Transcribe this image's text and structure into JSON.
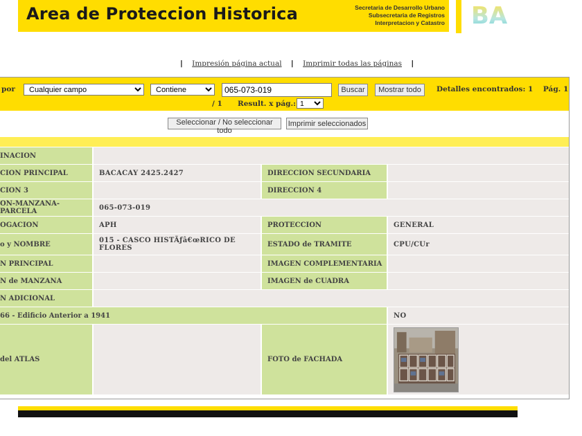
{
  "header": {
    "title": "Area de Proteccion Historica",
    "subtitle_lines": [
      "Secretaria de Desarrollo Urbano",
      "Subsecretaria de Registros",
      "Interpretacion y Catastro"
    ],
    "logo_text": "BA"
  },
  "print_links": {
    "current": "Impresión página actual",
    "all": "Imprimir todas las páginas"
  },
  "search": {
    "label": "por",
    "field_selected": "Cualquier campo",
    "operator_selected": "Contiene",
    "query_value": "065-073-019",
    "buscar_label": "Buscar",
    "mostrar_todo_label": "Mostrar todo",
    "detalles_text": "Detalles encontrados: 1",
    "pag_text": "Pág. 1",
    "pag_total_text": "/ 1",
    "result_label": "Result. x pág.:",
    "result_per_page": "1"
  },
  "actions": {
    "select_all_label": "Seleccionar / No seleccionar todo",
    "print_selected_label": "Imprimir seleccionados"
  },
  "record": {
    "denominacion_label": "INACION",
    "denominacion_value": "",
    "dir_principal_label": "CION PRINCIPAL",
    "dir_principal_value": "BACACAY 2425.2427",
    "dir_secundaria_label": "DIRECCION SECUNDARIA",
    "dir_secundaria_value": "",
    "dir3_label": "CION 3",
    "dir3_value": "",
    "dir4_label": "DIRECCION 4",
    "dir4_value": "",
    "smp_label": "ON-MANZANA-PARCELA",
    "smp_value": "065-073-019",
    "catalogacion_label": "OGACION",
    "catalogacion_value": "APH",
    "proteccion_label": "PROTECCION",
    "proteccion_value": "GENERAL",
    "nombre_label": "o y NOMBRE",
    "nombre_value": "015 - CASCO HISTÃƒâ€œRICO DE FLORES",
    "estado_label": "ESTADO de TRAMITE",
    "estado_value": "CPU/CUr",
    "img_principal_label": "N PRINCIPAL",
    "img_principal_value": "",
    "img_complementaria_label": "IMAGEN COMPLEMENTARIA",
    "img_complementaria_value": "",
    "img_manzana_label": "N de MANZANA",
    "img_manzana_value": "",
    "img_cuadra_label": "IMAGEN de CUADRA",
    "img_cuadra_value": "",
    "img_adicional_label": "N ADICIONAL",
    "img_adicional_value": "",
    "edificio_label": "66 - Edificio Anterior a 1941",
    "edificio_value": "NO",
    "atlas_label": "del ATLAS",
    "atlas_value": "",
    "fachada_label": "FOTO de FACHADA"
  },
  "colors": {
    "brand_yellow": "#ffdd00",
    "label_green": "#cfe29c",
    "value_grey": "#eeeae8"
  }
}
